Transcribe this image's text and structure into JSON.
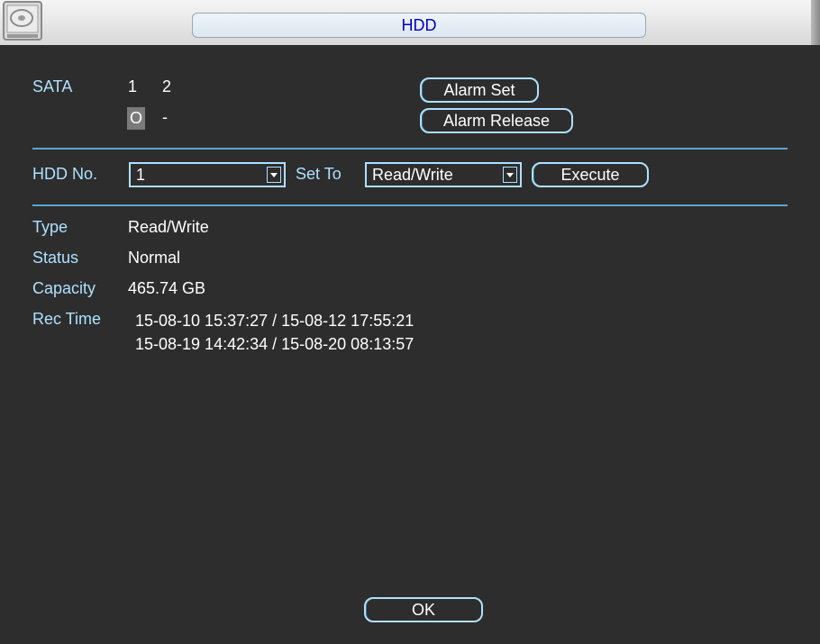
{
  "title": "HDD",
  "sata": {
    "label": "SATA",
    "port_1": "1",
    "port_2": "2",
    "port_1_status": "O",
    "port_2_status": "-"
  },
  "buttons": {
    "alarm_set": "Alarm Set",
    "alarm_release": "Alarm Release",
    "execute": "Execute",
    "ok": "OK"
  },
  "controls": {
    "hdd_no_label": "HDD No.",
    "hdd_no_value": "1",
    "set_to_label": "Set To",
    "set_to_value": "Read/Write"
  },
  "info": {
    "type_label": "Type",
    "type_value": "Read/Write",
    "status_label": "Status",
    "status_value": "Normal",
    "capacity_label": "Capacity",
    "capacity_value": "465.74 GB",
    "rec_time_label": "Rec Time",
    "rec_time_lines": [
      "15-08-10 15:37:27 / 15-08-12 17:55:21",
      "15-08-19 14:42:34 / 15-08-20 08:13:57"
    ]
  },
  "colors": {
    "background": "#2d2d2d",
    "accent": "#aee0ff",
    "title_text": "#0000c0"
  },
  "icons": [
    "hdd-icon",
    "dropdown-arrow-icon"
  ]
}
